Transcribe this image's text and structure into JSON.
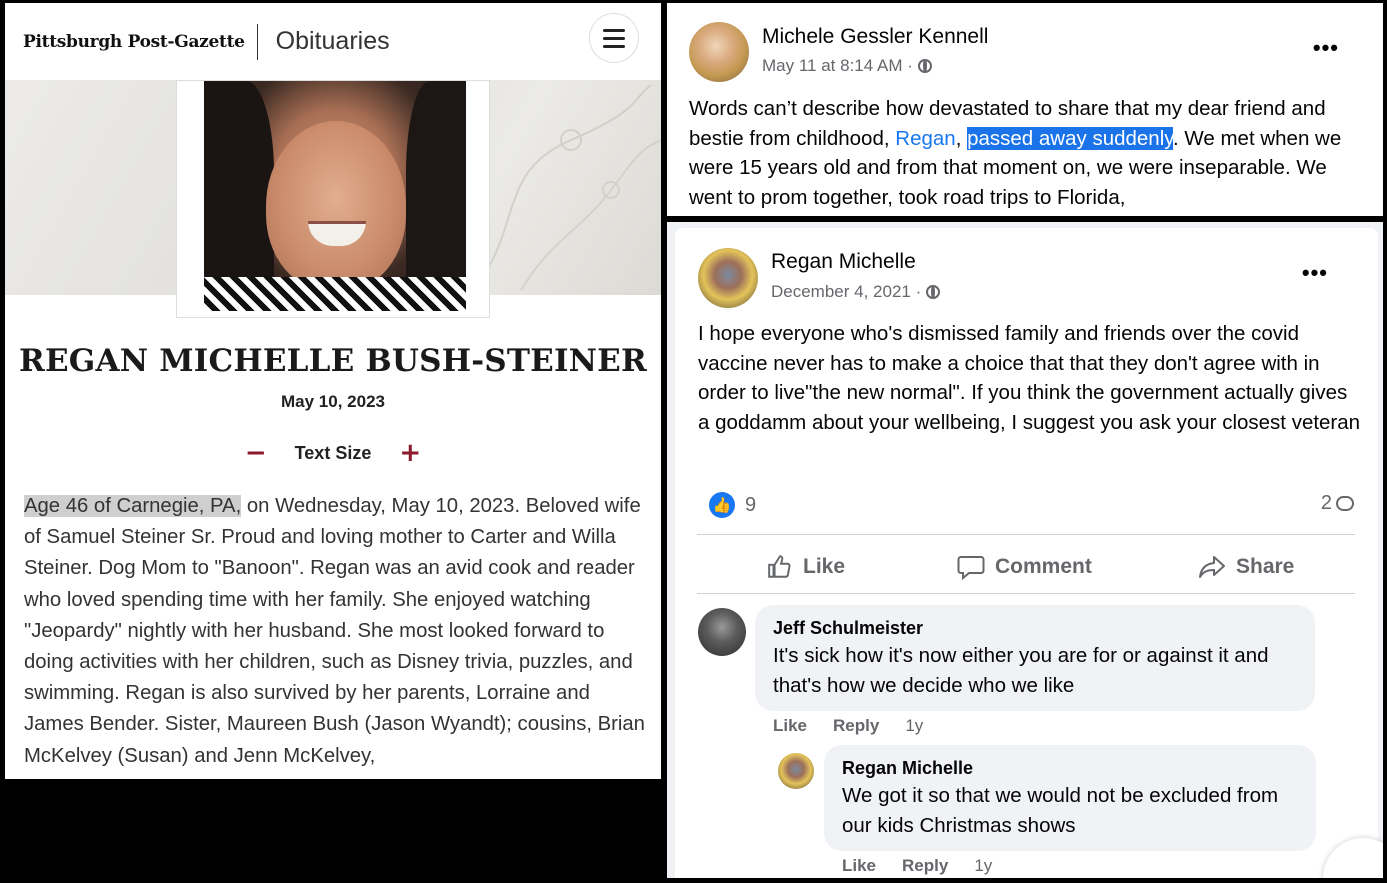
{
  "obituary": {
    "logo": "Pittsburgh Post-Gazette",
    "section": "Obituaries",
    "name": "REGAN MICHELLE BUSH-STEINER",
    "date": "May 10, 2023",
    "text_size_label": "Text Size",
    "minus": "−",
    "plus": "+",
    "body_highlight": "Age 46 of Carnegie, PA,",
    "body": " on Wednesday, May 10, 2023. Beloved wife of Samuel Steiner Sr. Proud and loving mother to Carter and Willa Steiner. Dog Mom to \"Banoon\". Regan was an avid cook and reader who loved spending time with her family. She enjoyed watching \"Jeopardy\" nightly with her husband. She most looked forward to doing activities with her children, such as Disney trivia, puzzles, and swimming. Regan is also survived by her parents, Lorraine and James Bender. Sister, Maureen Bush (Jason Wyandt); cousins, Brian McKelvey (Susan) and Jenn McKelvey,"
  },
  "post1": {
    "author": "Michele Gessler Kennell",
    "meta": "May 11 at 8:14 AM ·",
    "menu": "•••",
    "text_before": "Words can’t describe how devastated to share that my dear friend and bestie from childhood, ",
    "link": "Regan",
    "comma": ", ",
    "selected": "passed away suddenly",
    "text_after": ". We met when we were 15 years old and from that moment on, we were inseparable. We went to prom together, took road trips to Florida,"
  },
  "post2": {
    "author": "Regan Michelle",
    "meta": "December 4, 2021 ·",
    "menu": "•••",
    "text": "I hope everyone who's dismissed family and friends over the covid vaccine never has to make a choice that that they don't agree with in order to live\"the new normal\". If you think the government actually gives a goddamm about your wellbeing, I suggest you ask your closest veteran",
    "reactions": "9",
    "comments": "2",
    "actions": {
      "like": "Like",
      "comment": "Comment",
      "share": "Share"
    },
    "comment1": {
      "author": "Jeff Schulmeister",
      "text": "It's sick how it's now either you are for or against it and that's how we decide who we like",
      "like": "Like",
      "reply": "Reply",
      "age": "1y"
    },
    "comment2": {
      "author": "Regan Michelle",
      "text": "We got it so that we would not be excluded from our kids Christmas shows",
      "like": "Like",
      "reply": "Reply",
      "age": "1y"
    }
  }
}
